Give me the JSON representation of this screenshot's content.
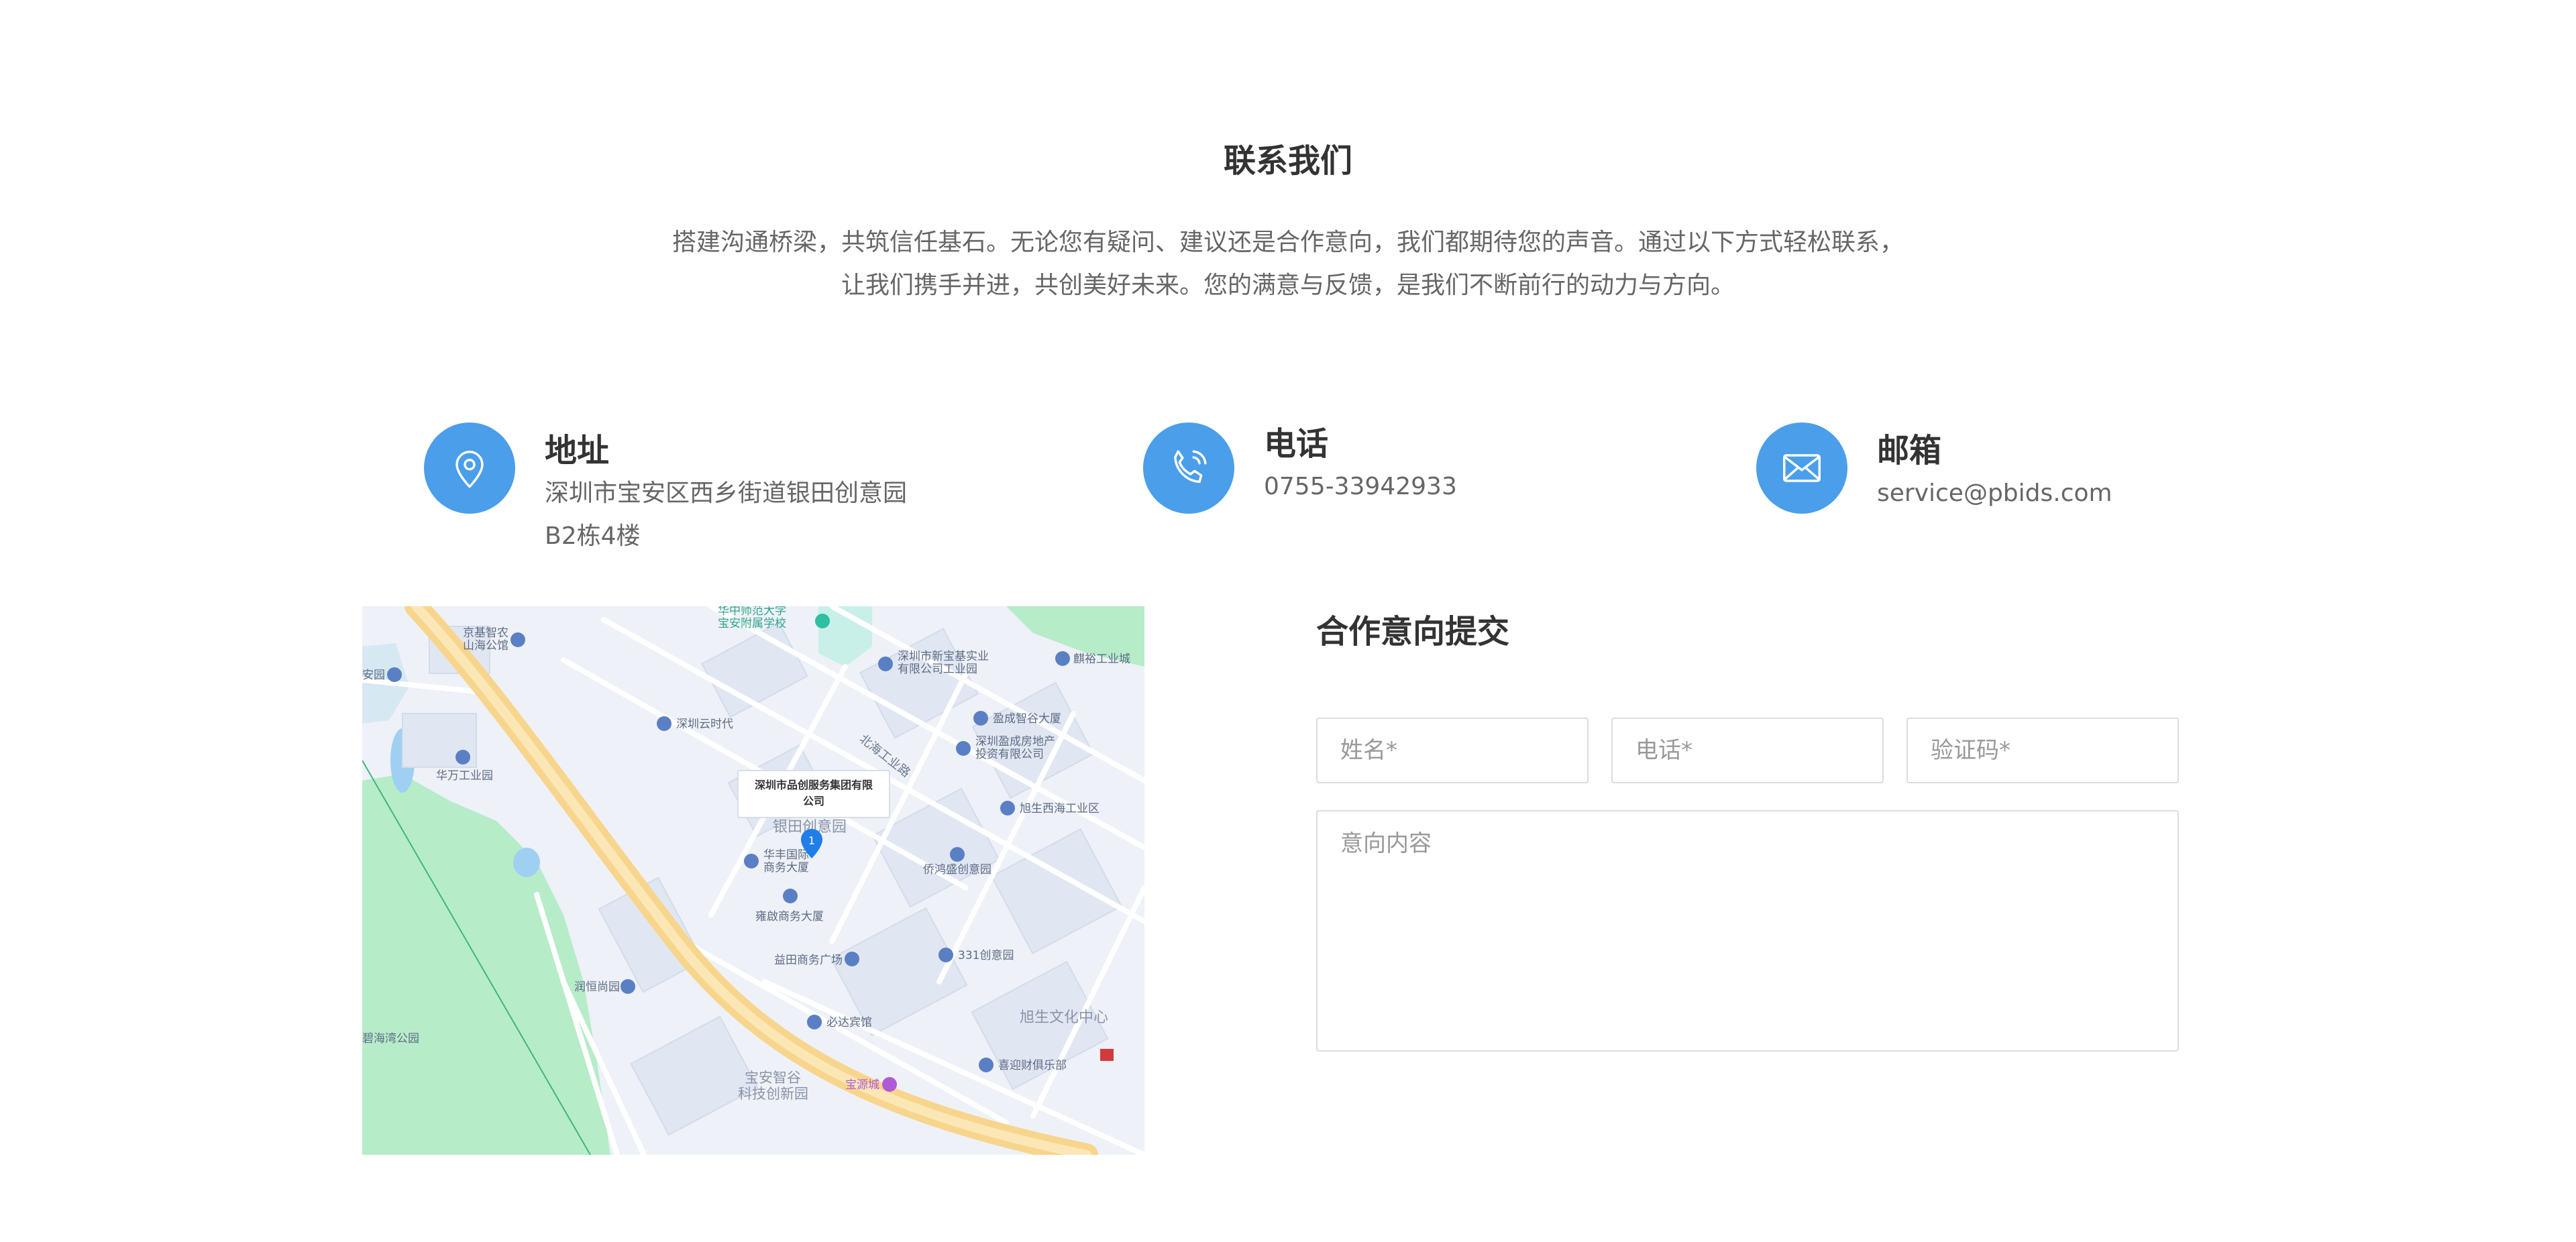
{
  "section": {
    "title": "联系我们",
    "intro_line1": "搭建沟通桥梁，共筑信任基石。无论您有疑问、建议还是合作意向，我们都期待您的声音。通过以下方式轻松联系，",
    "intro_line2": "让我们携手并进，共创美好未来。您的满意与反馈，是我们不断前行的动力与方向。"
  },
  "contacts": {
    "address": {
      "label": "地址",
      "value": "深圳市宝安区西乡街道银田创意园B2栋4楼",
      "icon": "location-pin-icon"
    },
    "phone": {
      "label": "电话",
      "value": "0755-33942933",
      "icon": "phone-icon"
    },
    "email": {
      "label": "邮箱",
      "value": "service@pbids.com",
      "icon": "mail-icon"
    }
  },
  "map": {
    "marker_label": "深圳市品创服务集团有限公司",
    "marker_number": "1",
    "pois": [
      "华中师范大学宝安附属学校",
      "深圳市新宝基实业有限公司工业园",
      "麒裕工业城",
      "京基智农山海公馆",
      "深圳云时代",
      "安园",
      "华万工业园",
      "盈成智谷大厦",
      "深圳盈成房地产投资有限公司",
      "旭生西海工业区",
      "银田创意园",
      "华丰国际商务大厦",
      "侨鸿盛创意园",
      "雍啟商务大厦",
      "331创意园",
      "益田商务广场",
      "润恒尚园",
      "旭生文化中心",
      "必达宾馆",
      "喜迎财俱乐部",
      "宝安智谷科技创新园",
      "宝源城",
      "碧海湾公园",
      "北海工业路"
    ]
  },
  "form": {
    "title": "合作意向提交",
    "name_placeholder": "姓名*",
    "phone_placeholder": "电话*",
    "captcha_placeholder": "验证码*",
    "content_placeholder": "意向内容"
  },
  "colors": {
    "accent": "#4a9eea",
    "text_dark": "#333333",
    "text_muted": "#666666",
    "border": "#dcdcdc"
  }
}
